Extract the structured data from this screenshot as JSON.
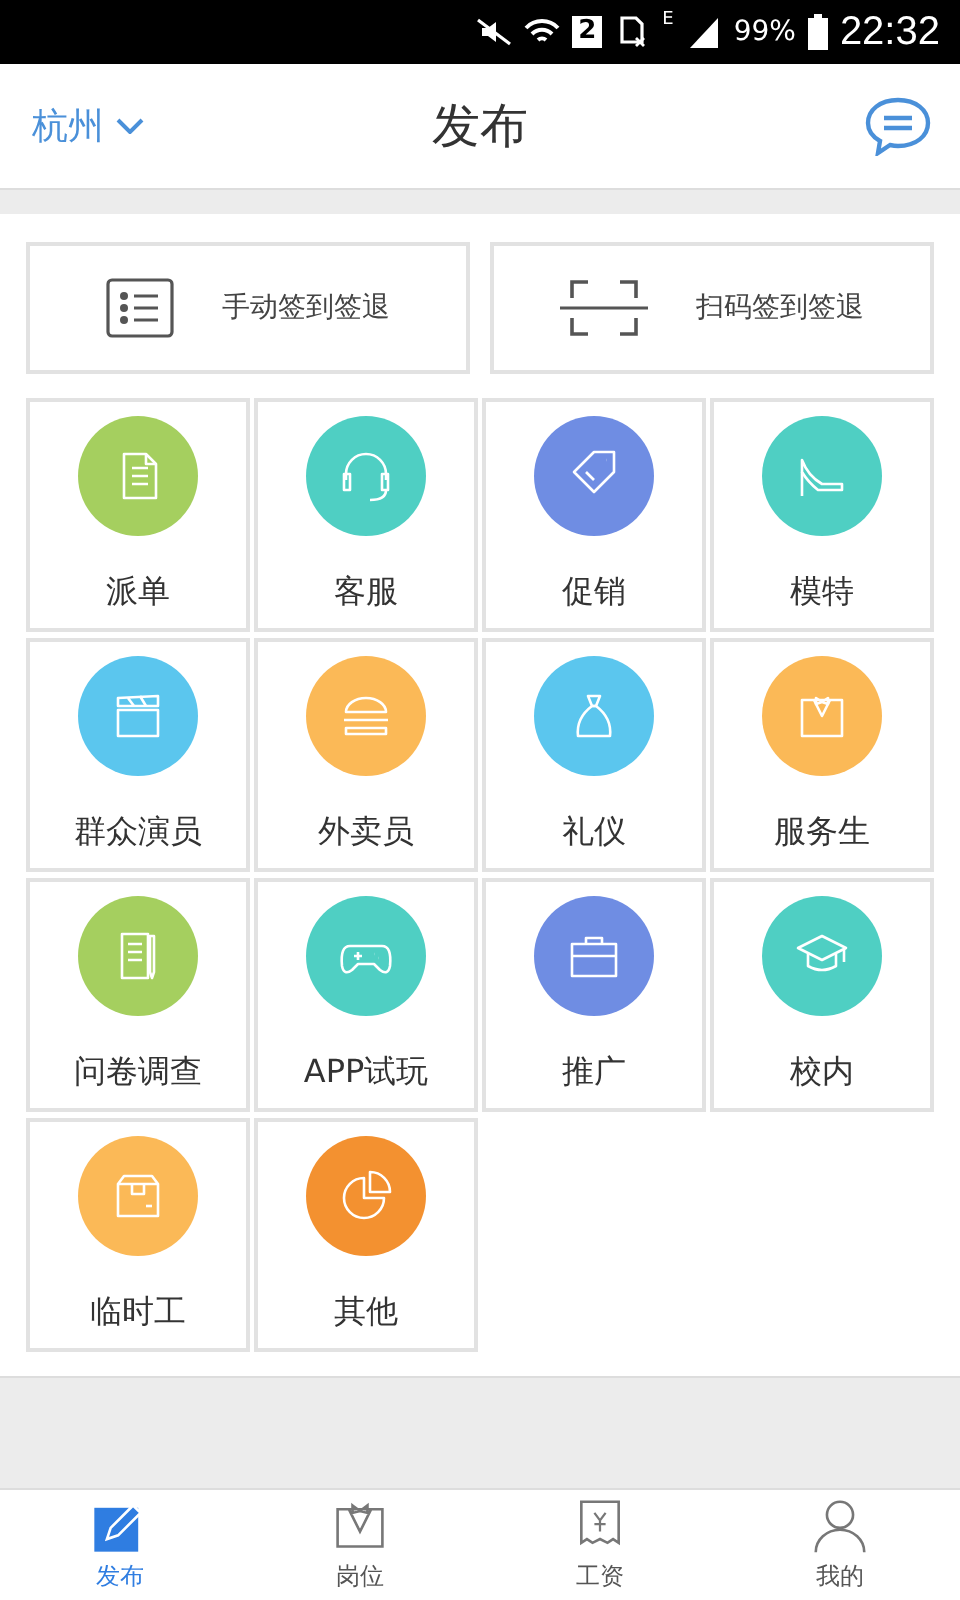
{
  "status_bar": {
    "sim": "2",
    "network": "E",
    "battery": "99%",
    "time": "22:32"
  },
  "header": {
    "city": "杭州",
    "title": "发布"
  },
  "quick_actions": [
    {
      "label": "手动签到签退"
    },
    {
      "label": "扫码签到签退"
    }
  ],
  "categories": [
    {
      "label": "派单",
      "color": "#a5cf5f"
    },
    {
      "label": "客服",
      "color": "#4fcfc3"
    },
    {
      "label": "促销",
      "color": "#6f8de3"
    },
    {
      "label": "模特",
      "color": "#4fcfc3"
    },
    {
      "label": "群众演员",
      "color": "#5bc6ee"
    },
    {
      "label": "外卖员",
      "color": "#fbb957"
    },
    {
      "label": "礼仪",
      "color": "#5bc6ee"
    },
    {
      "label": "服务生",
      "color": "#fbb957"
    },
    {
      "label": "问卷调查",
      "color": "#a5cf5f"
    },
    {
      "label": "APP试玩",
      "color": "#4fcfc3"
    },
    {
      "label": "推广",
      "color": "#6f8de3"
    },
    {
      "label": "校内",
      "color": "#4fcfc3"
    },
    {
      "label": "临时工",
      "color": "#fbb957"
    },
    {
      "label": "其他",
      "color": "#f39130"
    }
  ],
  "tab_bar": [
    {
      "label": "发布",
      "selected": true
    },
    {
      "label": "岗位",
      "selected": false
    },
    {
      "label": "工资",
      "selected": false
    },
    {
      "label": "我的",
      "selected": false
    }
  ]
}
